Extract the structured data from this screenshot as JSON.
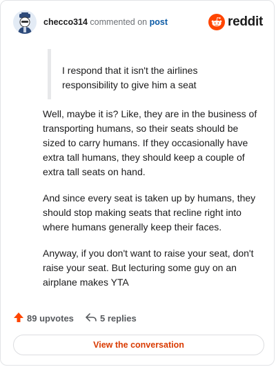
{
  "header": {
    "username": "checco314",
    "action_text": "commented on",
    "post_link": "post",
    "brand": "reddit",
    "brand_color": "#ff4500"
  },
  "comment": {
    "quote": "I respond that it isn't the airlines responsibility to give him a seat",
    "paragraphs": [
      "Well, maybe it is? Like, they are in the business of transporting humans, so their seats should be sized to carry humans. If they occasionally have extra tall humans, they should keep a couple of extra tall seats on hand.",
      "And since every seat is taken up by humans, they should stop making seats that recline right into where humans generally keep their faces.",
      "Anyway, if you don't want to raise your seat, don't raise your seat. But lecturing some guy on an airplane makes YTA"
    ]
  },
  "footer": {
    "upvotes": "89 upvotes",
    "replies": "5 replies",
    "upvote_icon": "upvote-arrow-icon",
    "reply_icon": "reply-arrow-icon",
    "view_button": "View the conversation",
    "accent_color": "#d93a00"
  }
}
